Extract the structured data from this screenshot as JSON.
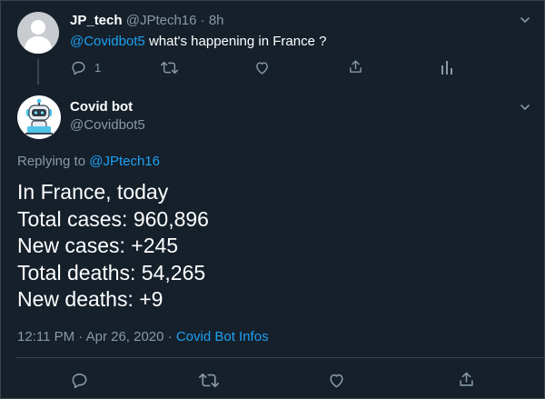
{
  "parent_tweet": {
    "author_name": "JP_tech",
    "author_handle": "@JPtech16",
    "separator": "·",
    "time_ago": "8h",
    "mention": "@Covidbot5",
    "text": "what's happening in France ?",
    "reply_count": "1",
    "icons": [
      "reply-icon",
      "retweet-icon",
      "like-icon",
      "share-icon",
      "analytics-icon"
    ]
  },
  "bot_tweet": {
    "author_name": "Covid bot",
    "author_handle": "@Covidbot5",
    "replying_to_label": "Replying to",
    "replying_to_handle": "@JPtech16",
    "lines": [
      "In France, today",
      "Total cases: 960,896",
      "New cases: +245",
      "Total deaths: 54,265",
      "New deaths: +9"
    ],
    "timestamp": "12:11 PM · Apr 26, 2020",
    "meta_separator": "·",
    "source": "Covid Bot Infos",
    "icons": [
      "reply-icon",
      "retweet-icon",
      "like-icon",
      "share-icon"
    ]
  },
  "colors": {
    "background": "#15202b",
    "text": "#ffffff",
    "muted": "#8899a6",
    "accent": "#1da1f2",
    "border": "#38444d"
  }
}
